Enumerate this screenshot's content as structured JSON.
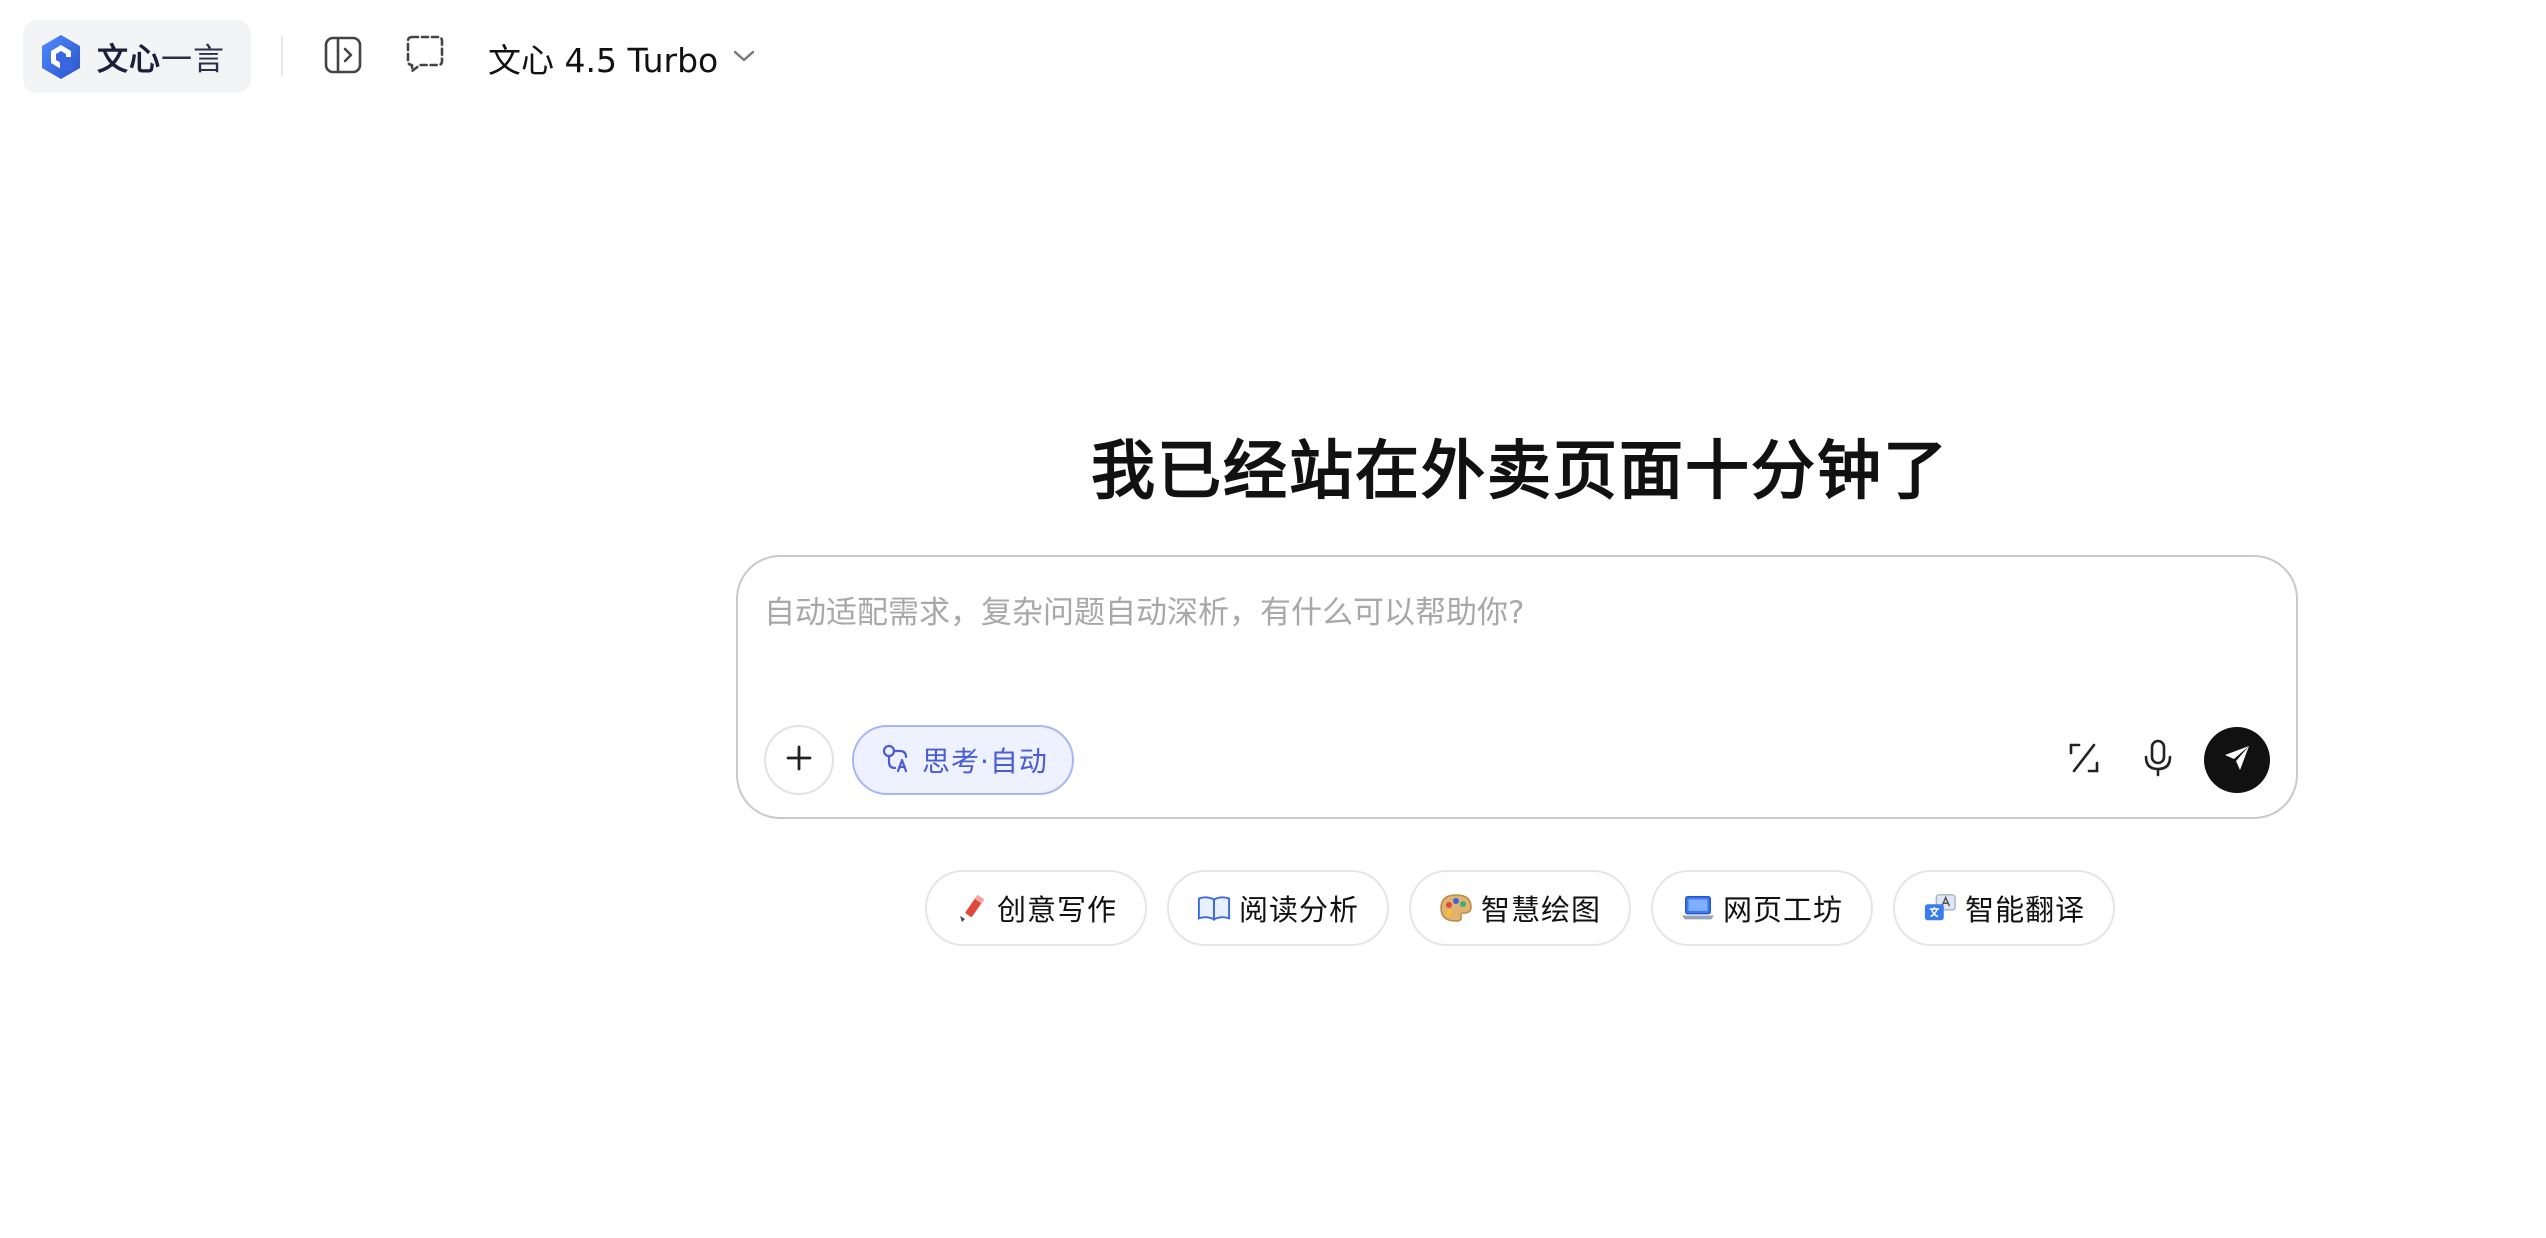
{
  "brand": {
    "name_bold": "文心",
    "name_light": "一言",
    "logo_icon": "wenxin-hexagon-logo",
    "accent_color": "#3a66e0"
  },
  "toolbar": {
    "sidebar_toggle_icon": "sidebar-toggle-icon",
    "new_chat_icon": "new-chat-icon",
    "model_name": "文心 4.5 Turbo",
    "model_dropdown_icon": "chevron-down-icon"
  },
  "main": {
    "headline": "我已经站在外卖页面十分钟了",
    "composer": {
      "placeholder": "自动适配需求，复杂问题自动深析，有什么可以帮助你?",
      "value": "",
      "attach_icon": "plus-icon",
      "think_mode_label": "思考·自动",
      "think_mode_icon": "think-mode-icon",
      "think_mode_color": "#4a5bd6",
      "format_icon": "slash-format-icon",
      "voice_icon": "microphone-icon",
      "send_icon": "send-arrow-icon"
    },
    "quick_actions": [
      {
        "label": "创意写作",
        "icon": "pencil-icon"
      },
      {
        "label": "阅读分析",
        "icon": "open-book-icon"
      },
      {
        "label": "智慧绘图",
        "icon": "palette-icon"
      },
      {
        "label": "网页工坊",
        "icon": "laptop-icon"
      },
      {
        "label": "智能翻译",
        "icon": "translate-icon"
      }
    ]
  }
}
